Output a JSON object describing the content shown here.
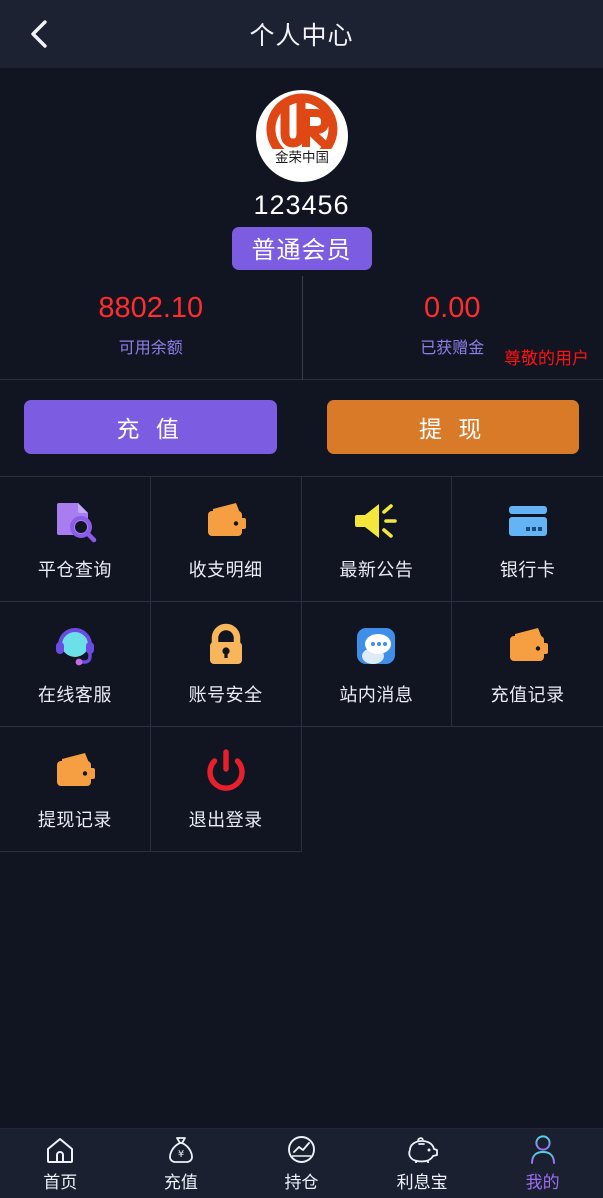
{
  "header": {
    "title": "个人中心",
    "back_icon": "chevron-left-icon"
  },
  "profile": {
    "avatar_icon": "brand-logo-icon",
    "avatar_brand_text": "金荣中国",
    "username": "123456",
    "badge": "普通会员",
    "stats": [
      {
        "value": "8802.10",
        "label": "可用余额"
      },
      {
        "value": "0.00",
        "label": "已获赠金"
      }
    ],
    "greeting": "尊敬的用户"
  },
  "actions": [
    {
      "label": "充 值",
      "name": "deposit-button",
      "color": "#7c5ce0"
    },
    {
      "label": "提 现",
      "name": "withdraw-button",
      "color": "#d87a28"
    }
  ],
  "grid": [
    {
      "label": "平仓查询",
      "icon": "document-search-icon"
    },
    {
      "label": "收支明细",
      "icon": "wallet-icon"
    },
    {
      "label": "最新公告",
      "icon": "megaphone-icon"
    },
    {
      "label": "银行卡",
      "icon": "bank-card-icon"
    },
    {
      "label": "在线客服",
      "icon": "headset-icon"
    },
    {
      "label": "账号安全",
      "icon": "lock-icon"
    },
    {
      "label": "站内消息",
      "icon": "chat-bubble-icon"
    },
    {
      "label": "充值记录",
      "icon": "wallet-icon"
    },
    {
      "label": "提现记录",
      "icon": "wallet-icon"
    },
    {
      "label": "退出登录",
      "icon": "power-icon"
    }
  ],
  "tabbar": [
    {
      "label": "首页",
      "icon": "home-icon",
      "active": false
    },
    {
      "label": "充值",
      "icon": "money-bag-icon",
      "active": false
    },
    {
      "label": "持仓",
      "icon": "chart-circle-icon",
      "active": false
    },
    {
      "label": "利息宝",
      "icon": "piggy-bank-icon",
      "active": false
    },
    {
      "label": "我的",
      "icon": "user-icon",
      "active": true
    }
  ],
  "colors": {
    "background": "#111521",
    "header_bg": "#1d2232",
    "accent_purple": "#7c5ce0",
    "accent_orange": "#d87a28",
    "value_red": "#ff2d2d",
    "label_purple": "#8f7fe8",
    "tabbar_bg": "#1b2030"
  }
}
